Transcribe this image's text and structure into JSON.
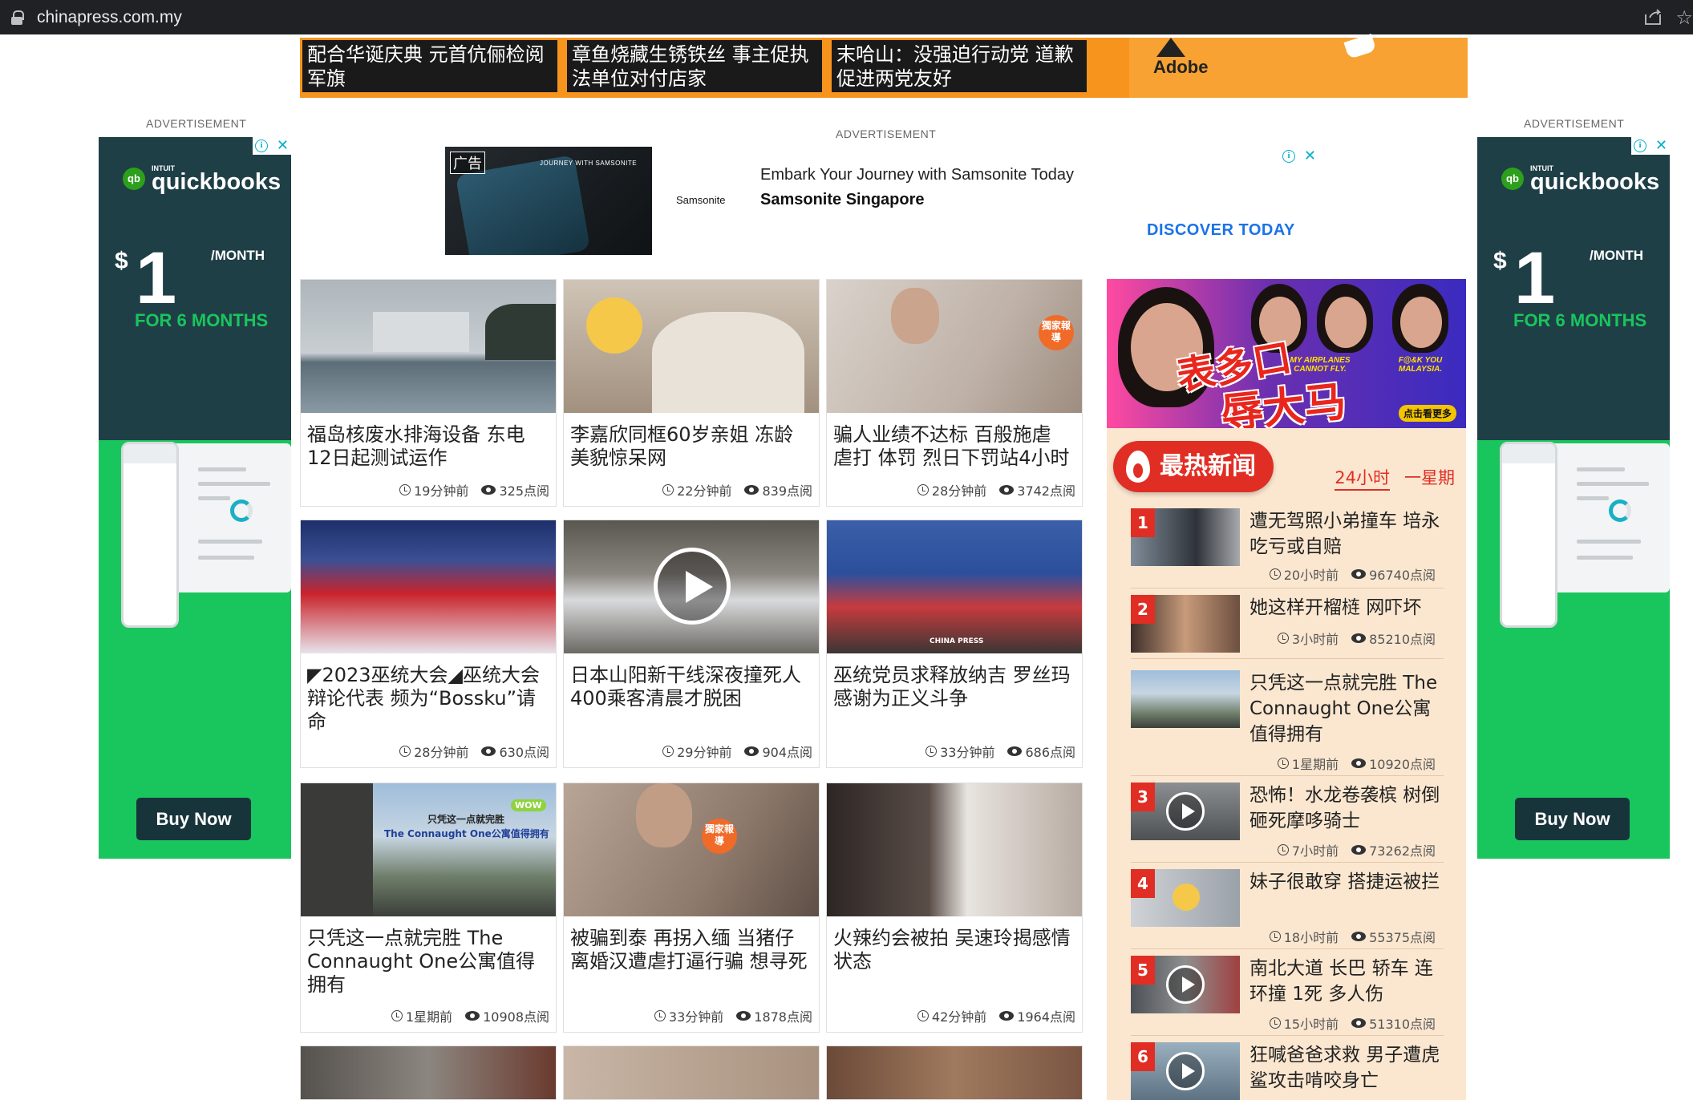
{
  "browser": {
    "url": "chinapress.com.my"
  },
  "ticker": {
    "items": [
      "配合华诞庆典 元首伉俪检阅军旗",
      "章鱼烧藏生锈铁丝 事主促执法单位对付店家",
      "末哈山：没强迫行动党 道歉促进两党友好"
    ],
    "adobe_label": "Adobe"
  },
  "ads": {
    "label": "ADVERTISEMENT",
    "quickbooks": {
      "brand_small": "INTUIT",
      "brand": "quickbooks",
      "price_symbol": "$",
      "price": "1",
      "per": "/MONTH",
      "duration": "FOR 6 MONTHS",
      "cta": "Buy Now"
    },
    "samsonite": {
      "tag": "广告",
      "tagline": "JOURNEY WITH SAMSONITE",
      "logo": "Samsonite",
      "headline": "Embark Your Journey with Samsonite Today",
      "advertiser": "Samsonite Singapore",
      "cta": "DISCOVER TODAY"
    }
  },
  "cards": [
    {
      "title": "福岛核废水排海设备 东电12日起测试运作",
      "time": "19分钟前",
      "views": "325点阅"
    },
    {
      "title": "李嘉欣同框60岁亲姐 冻龄美貌惊呆网",
      "time": "22分钟前",
      "views": "839点阅"
    },
    {
      "title": "骗人业绩不达标 百般施虐 虐打 体罚 烈日下罚站4小时",
      "time": "28分钟前",
      "views": "3742点阅"
    },
    {
      "title": "◤2023巫统大会◢巫统大会辩论代表 频为“Bossku”请命",
      "time": "28分钟前",
      "views": "630点阅"
    },
    {
      "title": "日本山阳新干线深夜撞死人 400乘客清晨才脱困",
      "time": "29分钟前",
      "views": "904点阅"
    },
    {
      "title": "巫统党员求释放纳吉 罗丝玛感谢为正义斗争",
      "time": "33分钟前",
      "views": "686点阅"
    },
    {
      "title": "只凭这一点就完胜 The Connaught One公寓值得拥有",
      "time": "1星期前",
      "views": "10908点阅"
    },
    {
      "title": "被骗到泰 再拐入缅 当猪仔 离婚汉遭虐打逼行骗 想寻死",
      "time": "33分钟前",
      "views": "1878点阅"
    },
    {
      "title": "火辣约会被拍 吴速玲揭感情状态",
      "time": "42分钟前",
      "views": "1964点阅"
    }
  ],
  "card_overlays": {
    "exclusive": "獨家報導",
    "connaught_line1": "只凭这一点就完胜",
    "connaught_line2": "The Connaught One公寓值得拥有",
    "wow": "WOW",
    "china_press": "CHINA PRESS"
  },
  "sidebar_banner": {
    "big_text_1": "表多口",
    "big_text_2": "辱大马",
    "caption_1": "MY AIRPLANES CANNOT FLY.",
    "caption_2": "F@&K YOU MALAYSIA.",
    "more": "点击看更多"
  },
  "hot": {
    "title": "最热新闻",
    "tabs": [
      "24小时",
      "一星期"
    ],
    "items": [
      {
        "rank": "1",
        "title": "遭无驾照小弟撞车 培永吃亏或自赔",
        "time": "20小时前",
        "views": "96740点阅"
      },
      {
        "rank": "2",
        "title": "她这样开榴梿 网吓坏",
        "time": "3小时前",
        "views": "85210点阅"
      },
      {
        "rank": "",
        "title": "只凭这一点就完胜 The Connaught One公寓值得拥有",
        "time": "1星期前",
        "views": "10920点阅"
      },
      {
        "rank": "3",
        "title": "恐怖！水龙卷袭槟 树倒砸死摩哆骑士",
        "time": "7小时前",
        "views": "73262点阅"
      },
      {
        "rank": "4",
        "title": "妹子很敢穿 搭捷运被拦",
        "time": "18小时前",
        "views": "55375点阅"
      },
      {
        "rank": "5",
        "title": "南北大道 长巴 轿车 连环撞 1死 多人伤",
        "time": "15小时前",
        "views": "51310点阅"
      },
      {
        "rank": "6",
        "title": "狂喊爸爸求救 男子遭虎鲨攻击啃咬身亡",
        "time": "",
        "views": ""
      }
    ]
  },
  "colors": {
    "accent_red": "#e02e24",
    "ticker_orange": "#f7941d",
    "quickbooks_green": "#19c55d",
    "quickbooks_dark": "#1f3f47",
    "sidebar_bg": "#fbe7d0",
    "link_blue": "#1a73e8"
  }
}
